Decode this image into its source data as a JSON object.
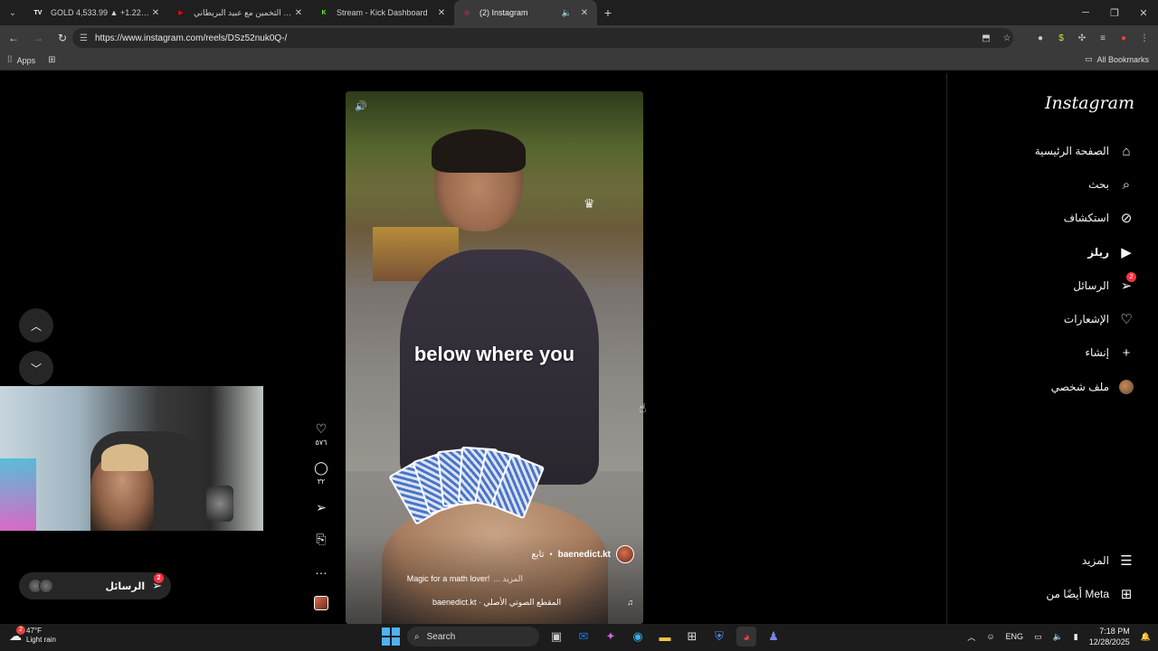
{
  "browser": {
    "tabs": [
      {
        "title": "GOLD 4,533.99 ▲ +1.22% Unn...",
        "favicon": "TV",
        "favicon_color": "#ffffff"
      },
      {
        "title": "تحدي التخمين مع عبيد البريطاني",
        "favicon": "▶",
        "favicon_color": "#ff0000"
      },
      {
        "title": "Stream - Kick Dashboard",
        "favicon": "K",
        "favicon_color": "#53fc18"
      },
      {
        "title": "(2) Instagram",
        "favicon": "◎",
        "favicon_color": "#e1306c",
        "active": true
      }
    ],
    "url": "https://www.instagram.com/reels/DSz52nuk0Q-/",
    "bookmarks": {
      "apps_label": "Apps",
      "all_bookmarks_label": "All Bookmarks"
    }
  },
  "instagram": {
    "logo": "Instagram",
    "nav": [
      {
        "label": "الصفحة الرئيسية",
        "icon": "home-icon",
        "glyph": "⌂"
      },
      {
        "label": "بحث",
        "icon": "search-icon",
        "glyph": "⌕"
      },
      {
        "label": "استكشاف",
        "icon": "compass-icon",
        "glyph": "⊘"
      },
      {
        "label": "ريلز",
        "icon": "reels-icon",
        "glyph": "▶"
      },
      {
        "label": "الرسائل",
        "icon": "messages-icon",
        "glyph": "➢",
        "badge": "2"
      },
      {
        "label": "الإشعارات",
        "icon": "heart-icon",
        "glyph": "♡"
      },
      {
        "label": "إنشاء",
        "icon": "plus-icon",
        "glyph": "+"
      },
      {
        "label": "ملف شخصي",
        "icon": "profile-avatar"
      }
    ],
    "more_label": "المزيد",
    "meta_label": "أيضًا من Meta",
    "reel": {
      "caption_overlay": "below where you",
      "author": "baenedict.kt",
      "follow_label": "تابع",
      "description": "Magic for a math lover!",
      "more_label": "... المزيد",
      "audio": "baenedict.kt · المقطع الصوتي الأصلي",
      "likes": "٥٧٦",
      "comments": "٣٢"
    },
    "messages_pill": {
      "label": "الرسائل",
      "badge": "2"
    }
  },
  "taskbar": {
    "weather_temp": "47°F",
    "weather_desc": "Light rain",
    "weather_badge": "2",
    "search_label": "Search",
    "lang": "ENG",
    "time": "7:18 PM",
    "date": "12/28/2025"
  }
}
